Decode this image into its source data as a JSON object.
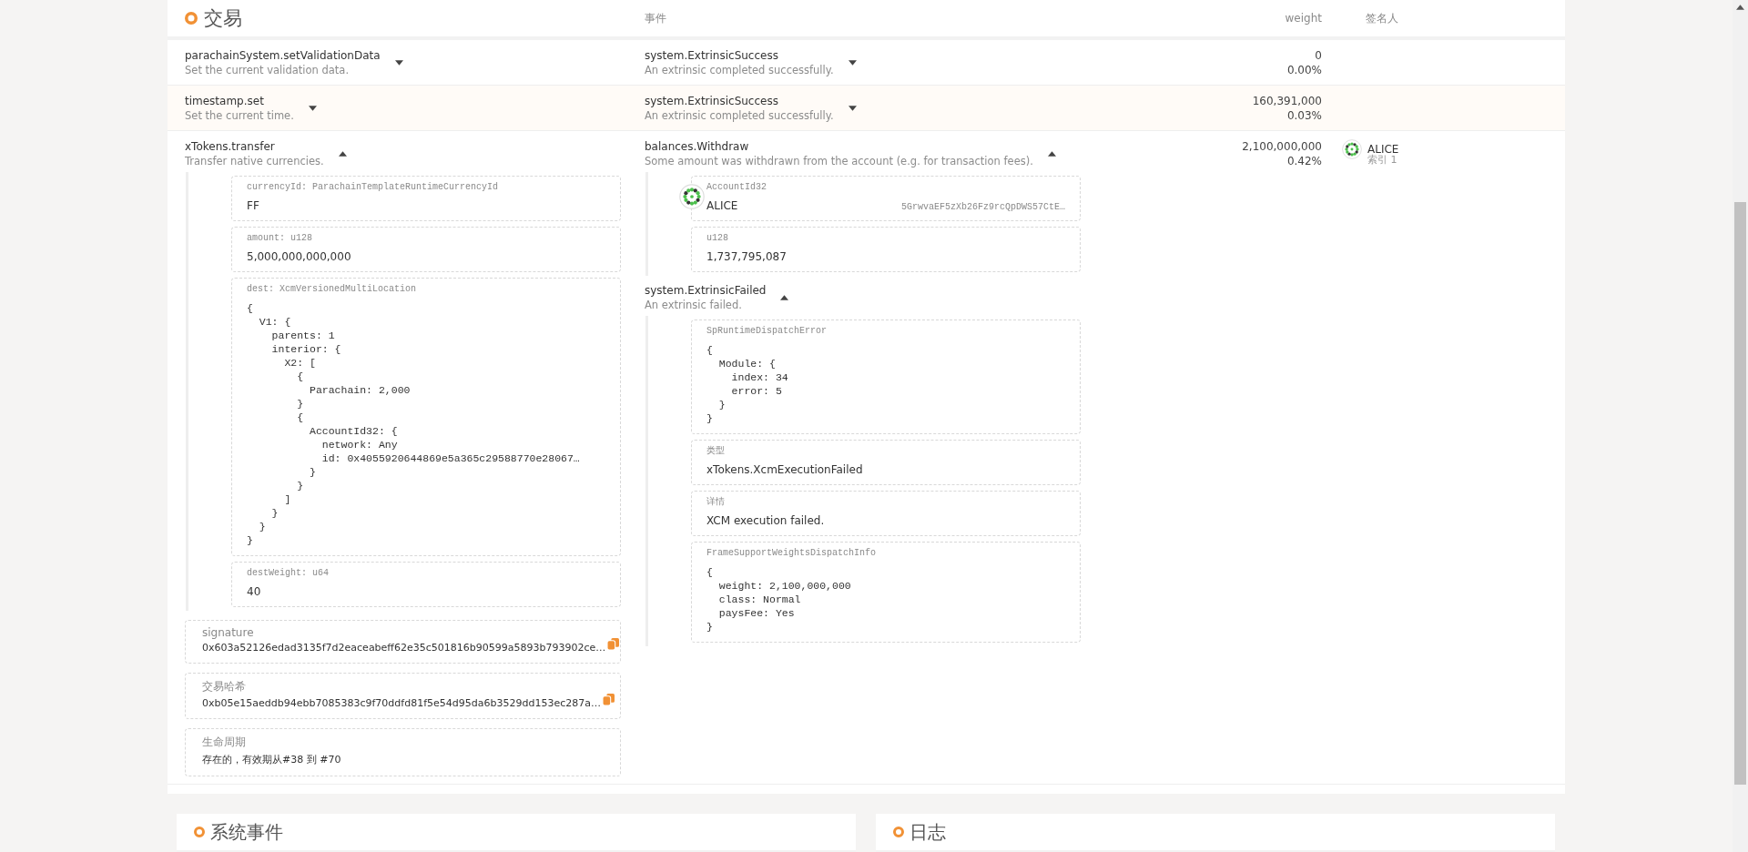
{
  "extrinsics_section": {
    "title": "交易",
    "columns": [
      "事件",
      "weight",
      "签名人"
    ],
    "rows": [
      {
        "name": "parachainSystem.setValidationData",
        "description": "Set the current validation data.",
        "expanded": false,
        "weight": "0",
        "weight_percent": "0.00%",
        "events": [
          {
            "name": "system.ExtrinsicSuccess",
            "description": "An extrinsic completed successfully.",
            "expanded": false
          }
        ]
      },
      {
        "name": "timestamp.set",
        "description": "Set the current time.",
        "expanded": false,
        "weight": "160,391,000",
        "weight_percent": "0.03%",
        "events": [
          {
            "name": "system.ExtrinsicSuccess",
            "description": "An extrinsic completed successfully.",
            "expanded": false
          }
        ]
      },
      {
        "name": "xTokens.transfer",
        "description": "Transfer native currencies.",
        "expanded": true,
        "weight": "2,100,000,000",
        "weight_percent": "0.42%",
        "signer": {
          "name": "ALICE",
          "index": "索引 1"
        },
        "params": [
          {
            "kind": "text",
            "label": "currencyId: ParachainTemplateRuntimeCurrencyId",
            "value": "FF"
          },
          {
            "kind": "text",
            "label": "amount: u128",
            "value": "5,000,000,000,000"
          },
          {
            "kind": "code",
            "label": "dest: XcmVersionedMultiLocation",
            "value": "{\n  V1: {\n    parents: 1\n    interior: {\n      X2: [\n        {\n          Parachain: 2,000\n        }\n        {\n          AccountId32: {\n            network: Any\n            id: 0x4055920644869e5a365c29588770e28067…\n          }\n        }\n      ]\n    }\n  }\n}"
          },
          {
            "kind": "text",
            "label": "destWeight: u64",
            "value": "40"
          }
        ],
        "details": [
          {
            "label": "signature",
            "value": "0x603a52126edad3135f7d2eaceabeff62e35c501816b90599a5893b793902ce…",
            "copyable": true
          },
          {
            "label": "交易哈希",
            "value": "0xb05e15aeddb94ebb7085383c9f70ddfd81f5e54d95da6b3529dd153ec287a…",
            "copyable": true
          },
          {
            "label": "生命周期",
            "value": "存在的，有效期从#38 到 #70",
            "copyable": false
          }
        ],
        "events": [
          {
            "name": "balances.Withdraw",
            "description": "Some amount was withdrawn from the account (e.g. for transaction fees).",
            "expanded": true,
            "params": [
              {
                "kind": "account",
                "label": "AccountId32",
                "value": "ALICE",
                "address": "5GrwvaEF5zXb26Fz9rcQpDWS57CtE…"
              },
              {
                "kind": "text",
                "label": "u128",
                "value": "1,737,795,087"
              }
            ]
          },
          {
            "name": "system.ExtrinsicFailed",
            "description": "An extrinsic failed.",
            "expanded": true,
            "params": [
              {
                "kind": "code",
                "label": "SpRuntimeDispatchError",
                "value": "{\n  Module: {\n    index: 34\n    error: 5\n  }\n}"
              },
              {
                "kind": "text",
                "label": "类型",
                "value": "xTokens.XcmExecutionFailed"
              },
              {
                "kind": "text",
                "label": "详情",
                "value": "XCM execution failed."
              },
              {
                "kind": "code",
                "label": "FrameSupportWeightsDispatchInfo",
                "value": "{\n  weight: 2,100,000,000\n  class: Normal\n  paysFee: Yes\n}"
              }
            ]
          }
        ]
      }
    ]
  },
  "panels": [
    {
      "title": "系统事件"
    },
    {
      "title": "日志"
    }
  ]
}
